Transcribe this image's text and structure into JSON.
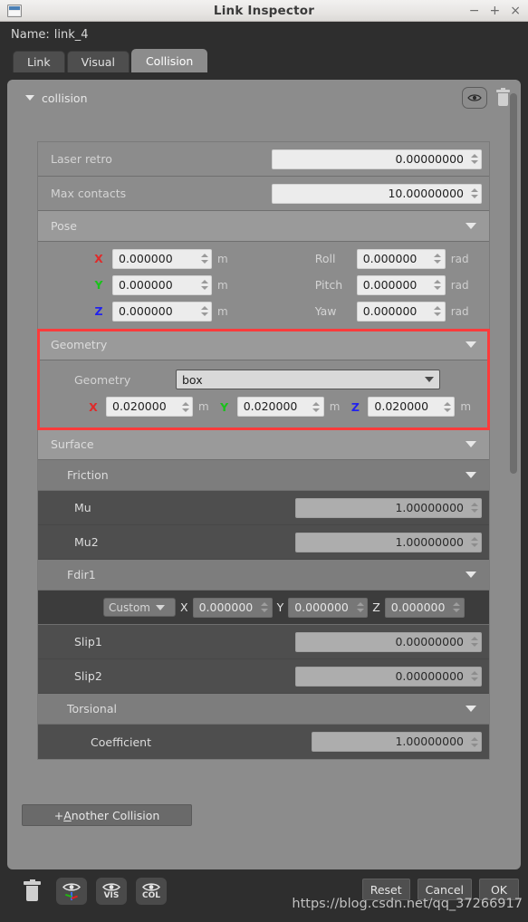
{
  "window": {
    "title": "Link Inspector",
    "icon": "window-icon",
    "controls": {
      "minimize": "−",
      "maximize": "+",
      "close": "×"
    }
  },
  "header": {
    "name_label": "Name:",
    "name_value": "link_4"
  },
  "tabs": [
    {
      "label": "Link",
      "active": false
    },
    {
      "label": "Visual",
      "active": false
    },
    {
      "label": "Collision",
      "active": true
    }
  ],
  "collision": {
    "title": "collision",
    "visible_icon": "eye-icon",
    "delete_icon": "trash-icon"
  },
  "fields": {
    "laser_retro": {
      "label": "Laser retro",
      "value": "0.00000000"
    },
    "max_contacts": {
      "label": "Max contacts",
      "value": "10.00000000"
    }
  },
  "pose": {
    "title": "Pose",
    "x": {
      "axis": "X",
      "value": "0.000000",
      "unit": "m"
    },
    "y": {
      "axis": "Y",
      "value": "0.000000",
      "unit": "m"
    },
    "z": {
      "axis": "Z",
      "value": "0.000000",
      "unit": "m"
    },
    "roll": {
      "label": "Roll",
      "value": "0.000000",
      "unit": "rad"
    },
    "pitch": {
      "label": "Pitch",
      "value": "0.000000",
      "unit": "rad"
    },
    "yaw": {
      "label": "Yaw",
      "value": "0.000000",
      "unit": "rad"
    }
  },
  "geometry": {
    "title": "Geometry",
    "field_label": "Geometry",
    "type_value": "box",
    "highlight_color": "#fc3b3b",
    "x": {
      "axis": "X",
      "value": "0.020000",
      "unit": "m"
    },
    "y": {
      "axis": "Y",
      "value": "0.020000",
      "unit": "m"
    },
    "z": {
      "axis": "Z",
      "value": "0.020000",
      "unit": "m"
    }
  },
  "surface": {
    "title": "Surface",
    "friction": {
      "title": "Friction",
      "mu": {
        "label": "Mu",
        "value": "1.00000000"
      },
      "mu2": {
        "label": "Mu2",
        "value": "1.00000000"
      },
      "fdir1": {
        "title": "Fdir1",
        "mode": "Custom",
        "x": {
          "axis": "X",
          "value": "0.000000"
        },
        "y": {
          "axis": "Y",
          "value": "0.000000"
        },
        "z": {
          "axis": "Z",
          "value": "0.000000"
        }
      },
      "slip1": {
        "label": "Slip1",
        "value": "0.00000000"
      },
      "slip2": {
        "label": "Slip2",
        "value": "0.00000000"
      },
      "torsional": {
        "title": "Torsional",
        "coefficient": {
          "label": "Coefficient",
          "value": "1.00000000"
        }
      }
    }
  },
  "actions": {
    "another_collision_prefix": "+ ",
    "another_collision_mnemonic": "A",
    "another_collision_rest": "nother Collision"
  },
  "bottom_bar": {
    "icons": [
      {
        "name": "trash-icon",
        "caption": ""
      },
      {
        "name": "eye-axes-icon",
        "caption": ""
      },
      {
        "name": "eye-vis-icon",
        "caption": "VIS"
      },
      {
        "name": "eye-col-icon",
        "caption": "COL"
      }
    ],
    "buttons": [
      {
        "label": "Reset"
      },
      {
        "label": "Cancel"
      },
      {
        "label": "OK"
      }
    ]
  },
  "watermark": "https://blog.csdn.net/qq_37266917",
  "colors": {
    "axis_x": "#e02a2a",
    "axis_y": "#19c21a",
    "axis_z": "#2222ee",
    "panel_bg": "#8c8c8c",
    "window_bg": "#2e2e2e",
    "highlight": "#fc3b3b"
  }
}
